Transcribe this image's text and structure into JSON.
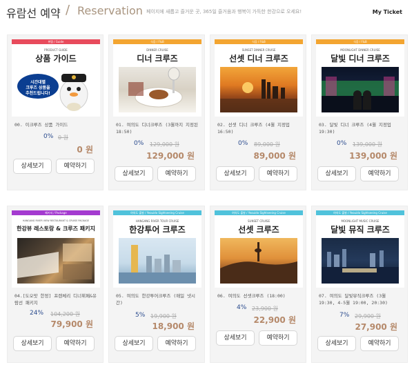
{
  "header": {
    "title": "유람선 예약",
    "slash": "/",
    "subtitle": "Reservation",
    "description": "페이지에 새롭고 즐거운 곳, 365일 즐거움과 행복이 가득한 한강으로 오세요!",
    "my_ticket": "My Ticket"
  },
  "colors": {
    "price": "#b5896a",
    "discount": "#2a4b8d",
    "band_red": "#e84b5c",
    "band_orange": "#f3a531",
    "band_purple": "#a43bd0",
    "band_blue": "#50c2db"
  },
  "buttons": {
    "detail": "상세보기",
    "reserve": "예약하기"
  },
  "products": [
    {
      "band": "위멤 / Guide",
      "band_color": "#e84b5c",
      "sub": "PRODUCT GUIDE",
      "title": "상품 가이드",
      "name": "00. 이크루즈 상품 가이드",
      "discount": "0%",
      "original": "0 원",
      "price": "0 원",
      "photo": "guide"
    },
    {
      "band": "식음 / F&B",
      "band_color": "#f3a531",
      "sub": "DINNER CRUISE",
      "title": "디너 크루즈",
      "name": "01. 여의도 디너크루즈 (3월까지 지정된 18:50)",
      "discount": "0%",
      "original": "129,000 원",
      "price": "129,000 원",
      "photo": "dinner"
    },
    {
      "band": "식음 / F&B",
      "band_color": "#f3a531",
      "sub": "SUNSET DINNER CRUISE",
      "title": "선셋 디너 크루즈",
      "name": "02. 선셋 디너 크루즈 (4월 지정업 16:50)",
      "discount": "0%",
      "original": "89,000 원",
      "price": "89,000 원",
      "photo": "sunset"
    },
    {
      "band": "식음 / F&B",
      "band_color": "#f3a531",
      "sub": "MOONLIGHT DINNER CRUISE",
      "title": "달빛 디너 크루즈",
      "name": "03. 달빛 디너 크루즈 (4월 지정업 19:30)",
      "discount": "0%",
      "original": "139,000 원",
      "price": "139,000 원",
      "photo": "moon"
    },
    {
      "band": "패키지 / Package",
      "band_color": "#a43bd0",
      "sub": "HANGANG RIVER VIEW RESTAURANT & CRUISE PACKAGE",
      "title": "한강뷰 레스토랑 & 크루즈 패키지",
      "name": "04.[도오맛 한정] 프렌체리 디너뷔페&유람선 패키지",
      "discount": "24%",
      "original": "104,200 원",
      "price": "79,900 원",
      "photo": "package"
    },
    {
      "band": "여의도 출발 / Yeouido Sightseeing Cruise",
      "band_color": "#50c2db",
      "sub": "HANGANG RIVER TOUR CRUISE",
      "title": "한강투어 크루즈",
      "name": "05. 여의도 한강투어크루즈 (매일 넷시간)",
      "discount": "5%",
      "original": "19,900 원",
      "price": "18,900 원",
      "photo": "tour"
    },
    {
      "band": "여의도 출발 / Yeouido Sightseeing Cruise",
      "band_color": "#50c2db",
      "sub": "SUNSET CRUISE",
      "title": "선셋 크루즈",
      "name": "06. 여의도 선셋크루즈 (18:00)",
      "discount": "4%",
      "original": "23,900 원",
      "price": "22,900 원",
      "photo": "sunset2"
    },
    {
      "band": "여의도 출발 / Yeouido Sightseeing Cruise",
      "band_color": "#50c2db",
      "sub": "MOONLIGHT MUSIC CRUISE",
      "title": "달빛 뮤직 크루즈",
      "name": "07. 여의도 달빛뮤직크루즈 (3월 19:30, 4-5월 19:00, 20:30)",
      "discount": "7%",
      "original": "29,900 원",
      "price": "27,900 원",
      "photo": "music"
    }
  ]
}
